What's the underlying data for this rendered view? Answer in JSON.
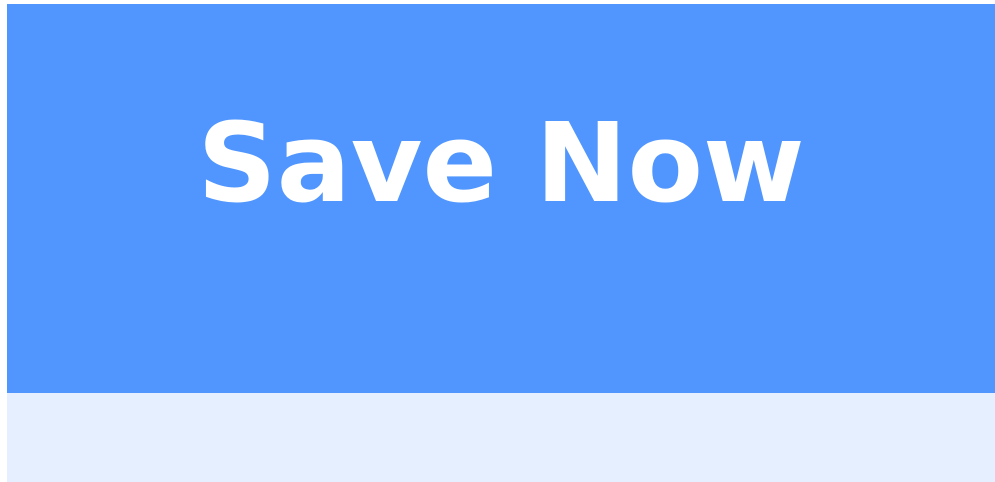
{
  "button": {
    "label": "Save Now"
  },
  "colors": {
    "button_background": "#5096fe",
    "button_text": "#ffffff",
    "footer_background": "#e6efff"
  }
}
